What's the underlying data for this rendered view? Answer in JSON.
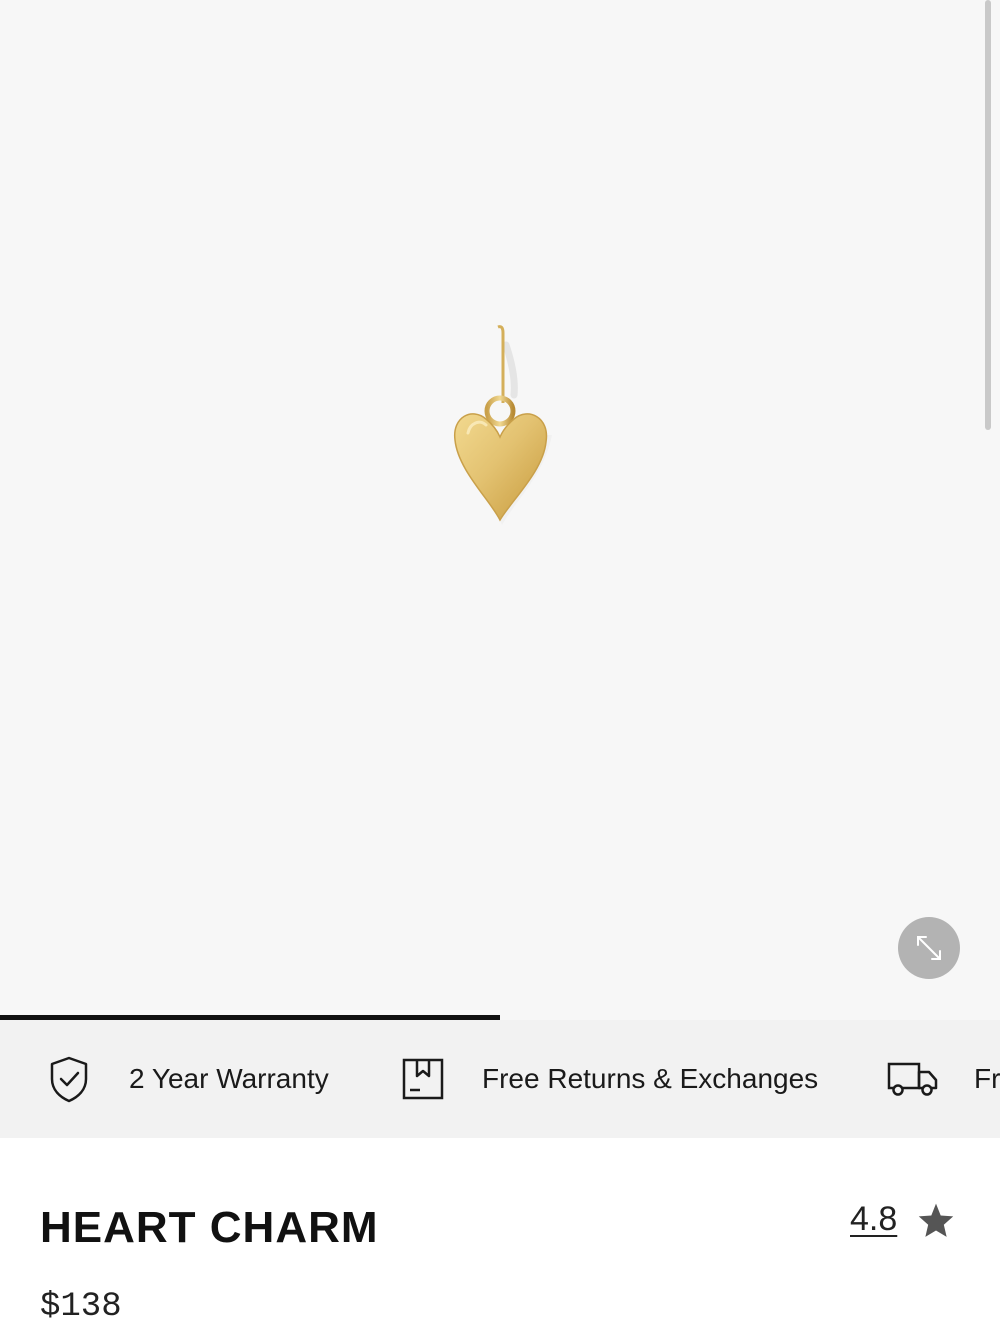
{
  "gallery": {
    "image_icon": "heart-charm-icon",
    "expand_icon": "expand-arrows-icon",
    "progress_fraction": 0.5
  },
  "benefits": [
    {
      "icon": "shield-check-icon",
      "label": "2 Year Warranty"
    },
    {
      "icon": "return-box-icon",
      "label": "Free Returns & Exchanges"
    },
    {
      "icon": "delivery-truck-icon",
      "label": "Fr"
    }
  ],
  "product": {
    "title": "HEART CHARM",
    "rating": "4.8",
    "rating_icon": "star-icon",
    "price": "$138"
  },
  "colors": {
    "gallery_bg": "#f7f7f7",
    "benefits_bg": "#f2f2f2",
    "gold": "#e2bf6a",
    "star": "#555555"
  }
}
